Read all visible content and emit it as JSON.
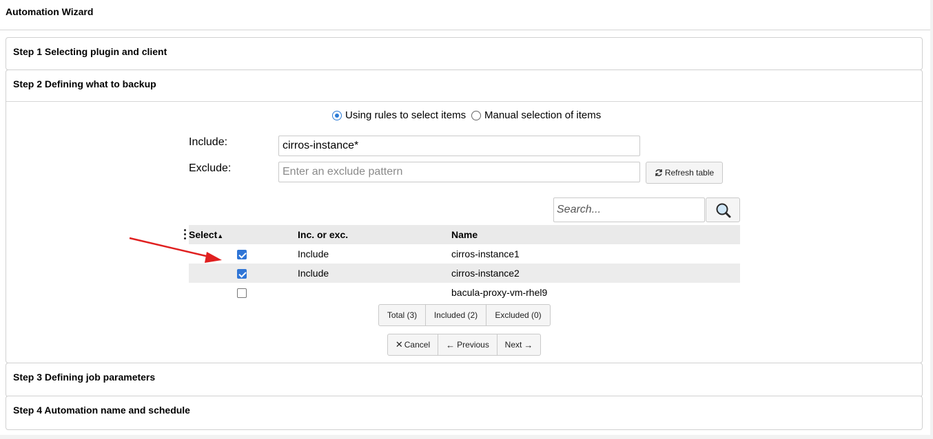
{
  "wizard": {
    "title": "Automation Wizard"
  },
  "steps": {
    "step1": "Step 1 Selecting plugin and client",
    "step2": "Step 2 Defining what to backup",
    "step3": "Step 3 Defining job parameters",
    "step4": "Step 4 Automation name and schedule"
  },
  "selection_mode": {
    "rules_label": "Using rules to select items",
    "manual_label": "Manual selection of items",
    "selected": "rules"
  },
  "form": {
    "include_label": "Include:",
    "include_value": "cirros-instance*",
    "exclude_label": "Exclude:",
    "exclude_placeholder": "Enter an exclude pattern",
    "refresh_label": "Refresh table"
  },
  "search": {
    "placeholder": "Search..."
  },
  "table": {
    "columns": [
      "Select",
      "Inc. or exc.",
      "Name"
    ],
    "rows": [
      {
        "checked": true,
        "type": "Include",
        "name": "cirros-instance1"
      },
      {
        "checked": true,
        "type": "Include",
        "name": "cirros-instance2"
      },
      {
        "checked": false,
        "type": "",
        "name": "bacula-proxy-vm-rhel9"
      }
    ]
  },
  "filters": {
    "total": "Total (3)",
    "included": "Included (2)",
    "excluded": "Excluded (0)"
  },
  "nav": {
    "cancel": "Cancel",
    "previous": "Previous",
    "next": "Next"
  },
  "colors": {
    "accent": "#2f75d6",
    "annotation_arrow": "#e02020"
  }
}
